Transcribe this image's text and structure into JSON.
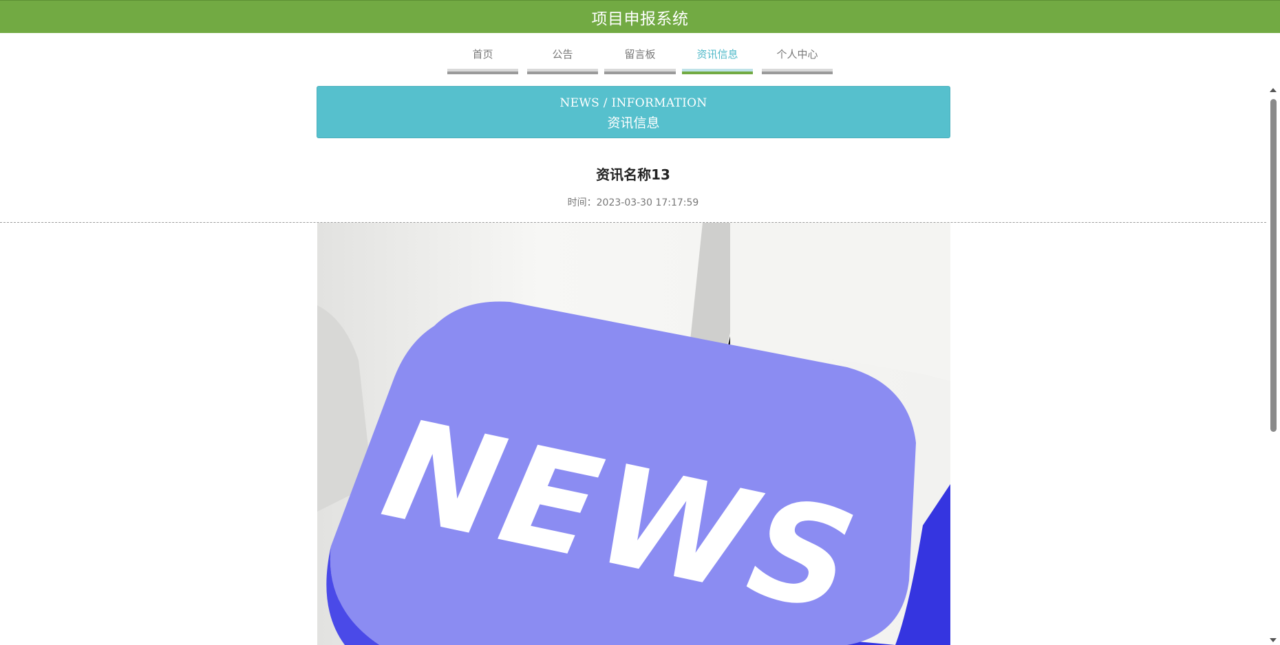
{
  "header": {
    "title": "项目申报系统",
    "color": "#72aa43"
  },
  "nav": {
    "items": [
      {
        "label": "首页",
        "active": false
      },
      {
        "label": "公告",
        "active": false
      },
      {
        "label": "留言板",
        "active": false
      },
      {
        "label": "资讯信息",
        "active": true
      },
      {
        "label": "个人中心",
        "active": false
      }
    ],
    "active_color": "#4db8c8"
  },
  "banner": {
    "en": "NEWS / INFORMATION",
    "cn": "资讯信息",
    "color": "#56c0cd"
  },
  "article": {
    "title": "资讯名称13",
    "time": "时间：2023-03-30 17:17:59",
    "image_text": "NEWS",
    "image_key_color": "#8b8cf2"
  }
}
